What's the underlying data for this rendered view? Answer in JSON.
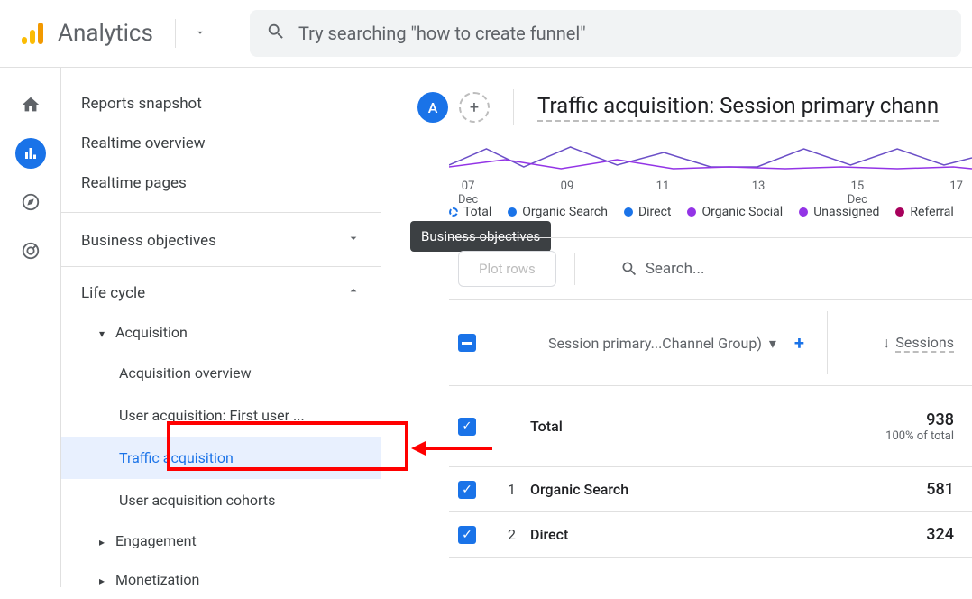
{
  "header": {
    "app_title": "Analytics",
    "search_placeholder": "Try searching \"how to create funnel\""
  },
  "nav": {
    "reports_snapshot": "Reports snapshot",
    "realtime_overview": "Realtime overview",
    "realtime_pages": "Realtime pages",
    "business_objectives": "Business objectives",
    "life_cycle": "Life cycle",
    "acquisition": "Acquisition",
    "acquisition_overview": "Acquisition overview",
    "user_acquisition": "User acquisition: First user ...",
    "traffic_acquisition": "Traffic acquisition",
    "user_acquisition_cohorts": "User acquisition cohorts",
    "engagement": "Engagement",
    "monetization": "Monetization"
  },
  "tooltip": {
    "business_objectives": "Business objectives"
  },
  "content": {
    "avatar_letter": "A",
    "page_title": "Traffic acquisition: Session primary chann"
  },
  "chart": {
    "x_labels": [
      "07\nDec",
      "09",
      "11",
      "13",
      "15\nDec",
      "17"
    ]
  },
  "legend": {
    "items": [
      {
        "label": "Total",
        "color": "#1a73e8",
        "dashed": true
      },
      {
        "label": "Organic Search",
        "color": "#1a73e8"
      },
      {
        "label": "Direct",
        "color": "#1a73e8"
      },
      {
        "label": "Organic Social",
        "color": "#9334e6"
      },
      {
        "label": "Unassigned",
        "color": "#9334e6"
      },
      {
        "label": "Referral",
        "color": "#a8005c"
      }
    ]
  },
  "table": {
    "plot_rows": "Plot rows",
    "search_placeholder": "Search...",
    "dimension_label": "Session primary...Channel Group)",
    "sessions_label": "Sessions",
    "total_label": "Total",
    "total_value": "938",
    "total_pct": "100% of total",
    "rows": [
      {
        "idx": "1",
        "name": "Organic Search",
        "sessions": "581"
      },
      {
        "idx": "2",
        "name": "Direct",
        "sessions": "324"
      }
    ]
  }
}
